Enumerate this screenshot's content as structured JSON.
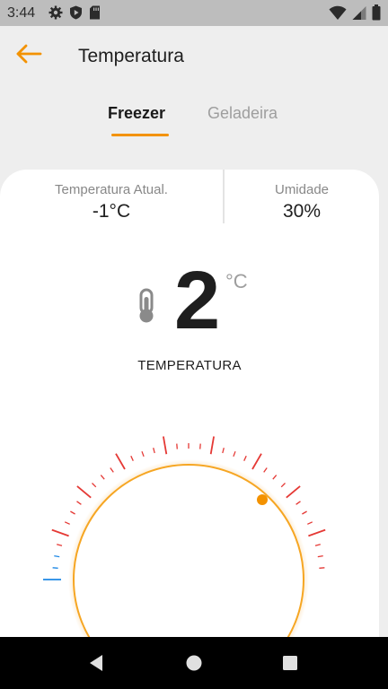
{
  "status_bar": {
    "time": "3:44",
    "left_icons": [
      "gear-icon",
      "shield-play-icon",
      "sd-card-icon"
    ],
    "right_icons": [
      "wifi-icon",
      "signal-icon",
      "battery-icon"
    ]
  },
  "app_bar": {
    "back_icon": "arrow-left-icon",
    "title": "Temperatura"
  },
  "tabs": [
    {
      "label": "Freezer",
      "selected": true
    },
    {
      "label": "Geladeira",
      "selected": false
    }
  ],
  "stats": {
    "current": {
      "label": "Temperatura Atual.",
      "value": "-1°C"
    },
    "humidity": {
      "label": "Umidade",
      "value": "30%"
    }
  },
  "temperature": {
    "value": "2",
    "unit": "°C",
    "caption": "TEMPERATURA",
    "icon": "thermometer-icon"
  },
  "colors": {
    "accent": "#f39200",
    "tick_red": "#e53935",
    "tick_blue": "#1e88e5",
    "background": "#eeeeee"
  },
  "nav_bar": {
    "buttons": [
      "back-triangle-icon",
      "home-circle-icon",
      "recents-square-icon"
    ]
  }
}
